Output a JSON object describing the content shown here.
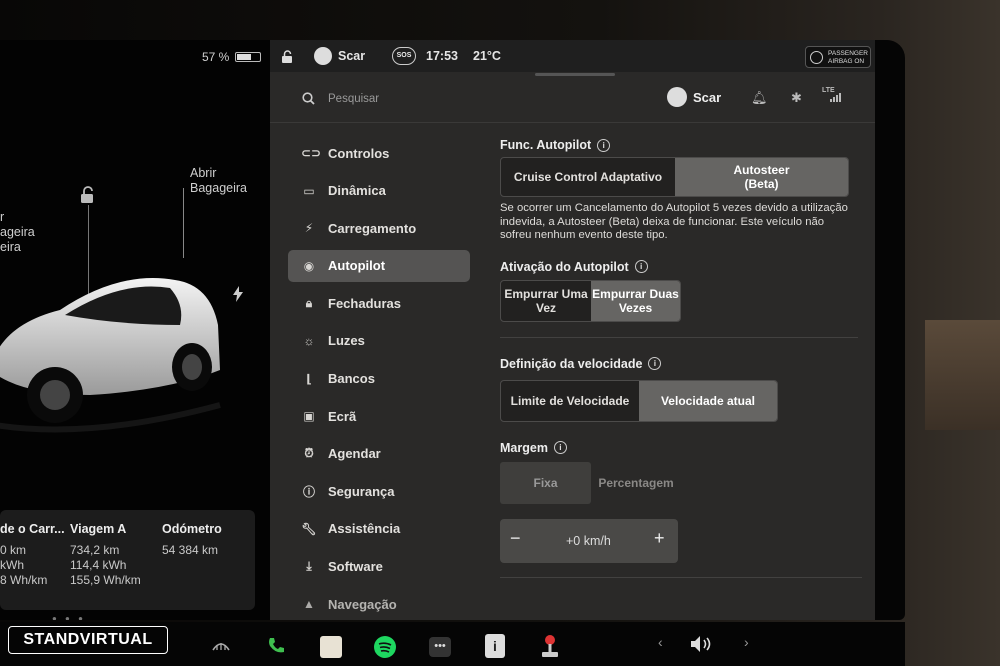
{
  "status": {
    "battery_percent": "57 %",
    "driver": "Scar",
    "sos": "SOS",
    "time": "17:53",
    "temperature": "21°C",
    "airbag_line1": "PASSENGER",
    "airbag_line2": "AIRBAG ON",
    "network": "LTE"
  },
  "car": {
    "label_trunk_line1": "Abrir",
    "label_trunk_line2": "Bagageira",
    "label_frunk_line1": "r",
    "label_frunk_line2": "ageira",
    "label_frunk_line3": "eira"
  },
  "stats": {
    "col1_title": "de o Carr...",
    "col1_v1": "0 km",
    "col1_v2": "kWh",
    "col1_v3": "8 Wh/km",
    "col2_title": "Viagem A",
    "col2_v1": "734,2 km",
    "col2_v2": "114,4 kWh",
    "col2_v3": "155,9 Wh/km",
    "col3_title": "Odómetro",
    "col3_v1": "54 384 km"
  },
  "search": {
    "placeholder": "Pesquisar"
  },
  "header": {
    "user": "Scar"
  },
  "menu": [
    {
      "label": "Controlos",
      "icon": "toggle-icon"
    },
    {
      "label": "Dinâmica",
      "icon": "car-icon"
    },
    {
      "label": "Carregamento",
      "icon": "bolt-icon"
    },
    {
      "label": "Autopilot",
      "icon": "steering-wheel-icon"
    },
    {
      "label": "Fechaduras",
      "icon": "lock-icon"
    },
    {
      "label": "Luzes",
      "icon": "sun-icon"
    },
    {
      "label": "Bancos",
      "icon": "seat-icon"
    },
    {
      "label": "Ecrã",
      "icon": "display-icon"
    },
    {
      "label": "Agendar",
      "icon": "clock-icon"
    },
    {
      "label": "Segurança",
      "icon": "alert-icon"
    },
    {
      "label": "Assistência",
      "icon": "wrench-icon"
    },
    {
      "label": "Software",
      "icon": "download-icon"
    },
    {
      "label": "Navegação",
      "icon": "navigation-icon"
    }
  ],
  "autopilot": {
    "features_title": "Func. Autopilot",
    "feature_opt1": "Cruise Control Adaptativo",
    "feature_opt2_line1": "Autosteer",
    "feature_opt2_line2": "(Beta)",
    "description": "Se ocorrer um Cancelamento do Autopilot 5 vezes devido a utilização indevida, a Autosteer (Beta) deixa de funcionar. Este veículo não sofreu nenhum evento deste tipo.",
    "activation_title": "Ativação do Autopilot",
    "activation_opt1_line1": "Empurrar Uma",
    "activation_opt1_line2": "Vez",
    "activation_opt2_line1": "Empurrar Duas",
    "activation_opt2_line2": "Vezes",
    "speed_title": "Definição da velocidade",
    "speed_opt1": "Limite de Velocidade",
    "speed_opt2": "Velocidade atual",
    "margin_title": "Margem",
    "margin_opt1": "Fixa",
    "margin_opt2": "Percentagem",
    "offset_minus": "−",
    "offset_value": "+0 km/h",
    "offset_plus": "+"
  },
  "watermark": "STANDVIRTUAL"
}
